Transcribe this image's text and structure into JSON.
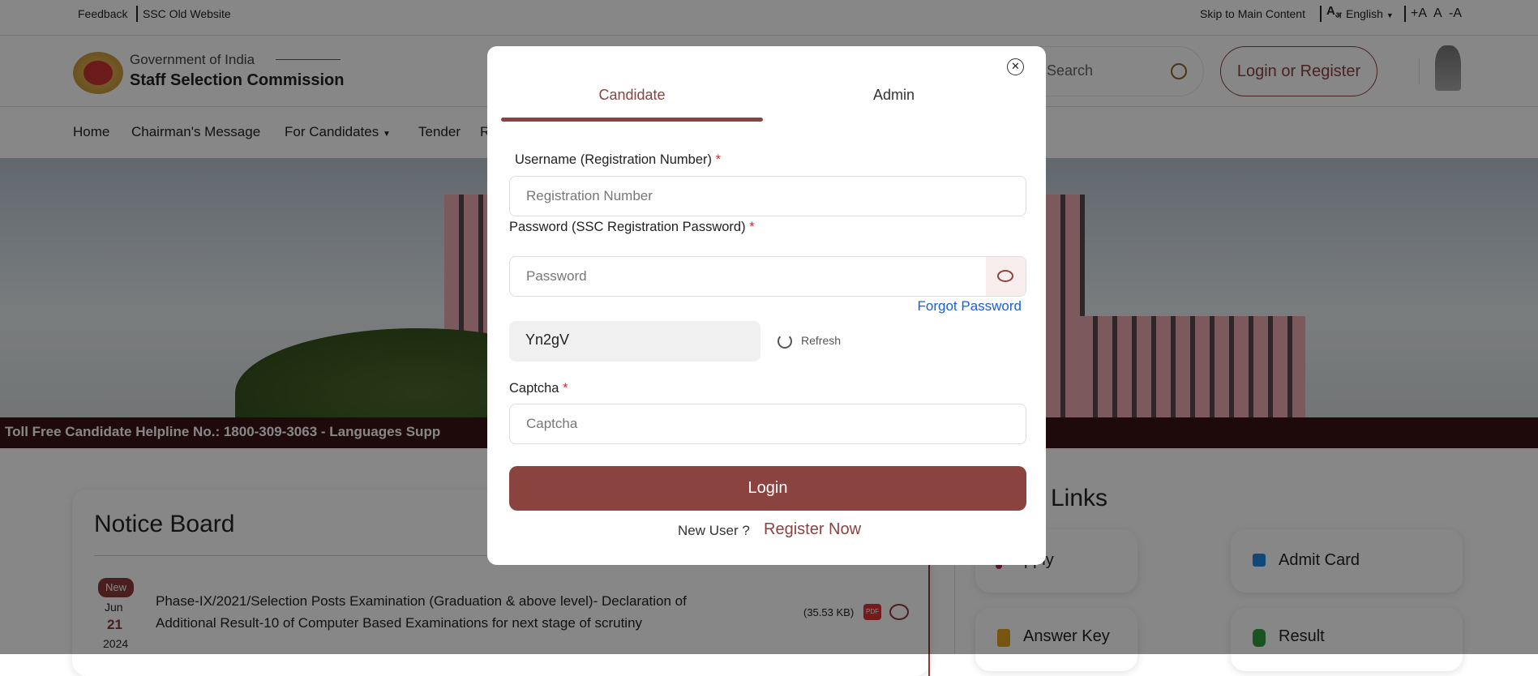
{
  "topbar": {
    "feedback": "Feedback",
    "old_site": "SSC Old Website",
    "skip": "Skip to Main Content",
    "lang_glyph": "A",
    "lang_sub": "अ",
    "language": "English",
    "font_plus": "+A",
    "font_normal": "A",
    "font_minus": "-A"
  },
  "header": {
    "gov": "Government of India",
    "org": "Staff Selection Commission",
    "search_placeholder": "Search",
    "login_register": "Login or Register"
  },
  "nav": {
    "items": [
      "Home",
      "Chairman's Message",
      "For Candidates",
      "Tender",
      "R"
    ]
  },
  "helpline": "Toll Free Candidate Helpline No.: 1800-309-3063 - Languages Supp",
  "notice": {
    "title": "Notice Board",
    "items": [
      {
        "badge": "New",
        "month": "Jun",
        "day": "21",
        "year": "2024",
        "text_line1": "Phase-IX/2021/Selection Posts Examination (Graduation & above level)- Declaration of",
        "text_line2": "Additional Result-10 of Computer Based Examinations for next stage of scrutiny",
        "size": "(35.53 KB)",
        "pdf": "PDF"
      }
    ]
  },
  "quick_links": {
    "title": "Links",
    "items": [
      {
        "label": "pply",
        "icon": "apply-icon",
        "color": "#c2185b"
      },
      {
        "label": "Admit Card",
        "icon": "admit-card-icon",
        "color": "#1e88e5"
      },
      {
        "label": "Answer Key",
        "icon": "answer-key-icon",
        "color": "#e0a020"
      },
      {
        "label": "Result",
        "icon": "result-icon",
        "color": "#2e9e3e"
      }
    ]
  },
  "modal": {
    "tabs": [
      {
        "label": "Candidate",
        "active": true
      },
      {
        "label": "Admin",
        "active": false
      }
    ],
    "username_label": "Username (Registration Number)",
    "username_placeholder": "Registration Number",
    "password_label": "Password (SSC Registration Password)",
    "password_placeholder": "Password",
    "forgot": "Forgot Password",
    "captcha_code": "Yn2gV",
    "refresh": "Refresh",
    "captcha_label": "Captcha",
    "captcha_placeholder": "Captcha",
    "required_mark": "*",
    "login": "Login",
    "new_user": "New User ?",
    "register": "Register Now"
  },
  "colors": {
    "brand": "#8b4340",
    "link": "#1a5fd6",
    "helpline_bg": "#3a1414"
  }
}
